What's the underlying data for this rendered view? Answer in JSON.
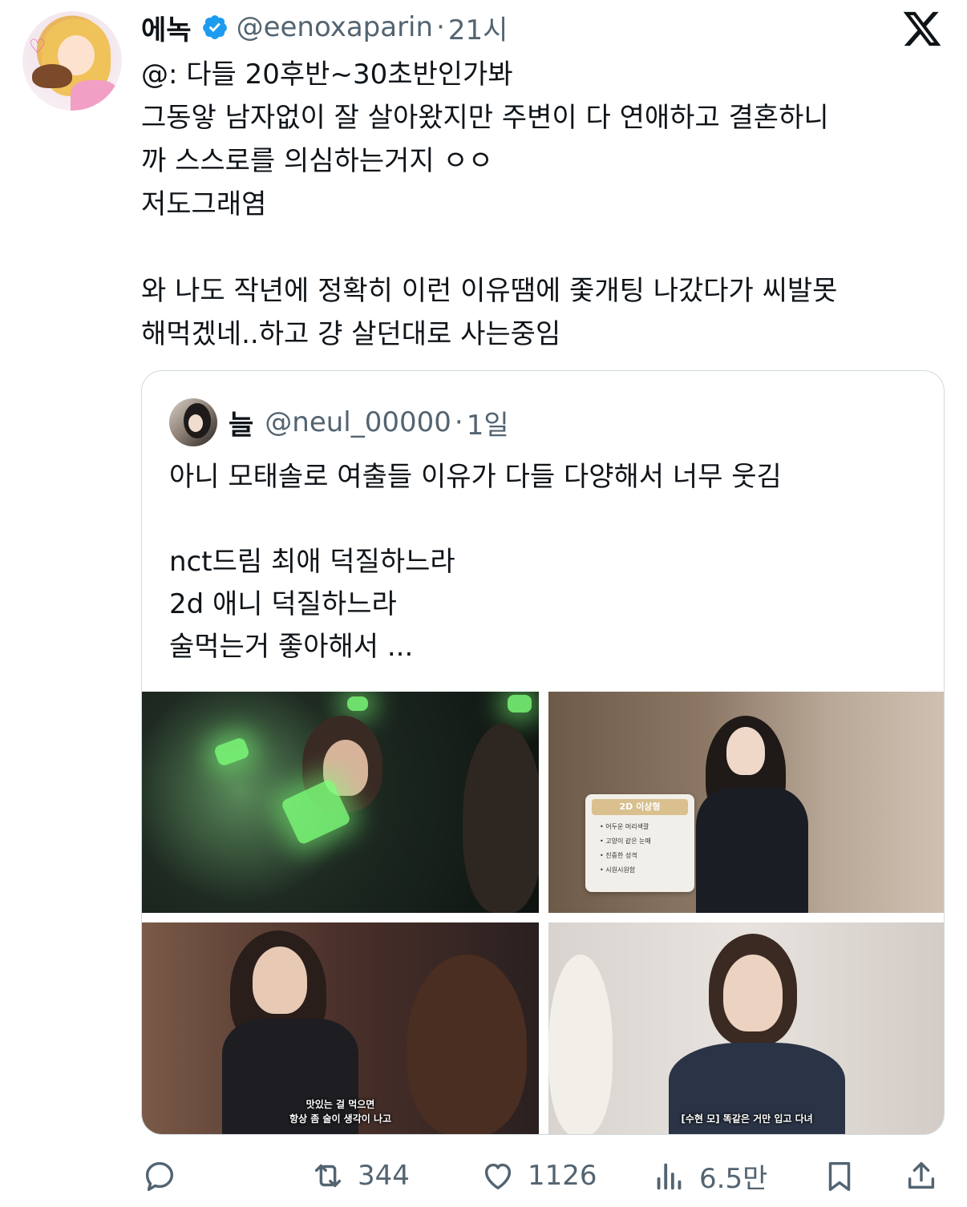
{
  "tweet": {
    "author_name": "에녹",
    "handle": "@eenoxaparin",
    "separator": "·",
    "time": "21시",
    "text": "@: 다들 20후반~30초반인가봐\n그동앟 남자없이 잘 살아왔지만 주변이 다 연애하고 결혼하니\n까 스스로를 의심하는거지 ㅇㅇ\n저도그래염\n\n와 나도 작년에 정확히 이런 이유땜에 좇개팅 나갔다가 씨발못\n해먹겠네..하고 걍 살던대로 사는중임"
  },
  "quote": {
    "author_name": "늘",
    "handle": "@neul_00000",
    "separator": "·",
    "time": "1일",
    "text": "아니 모태솔로 여출들 이유가 다들 다양해서 너무 웃김\n\nnct드림 최애 덕질하느라\n2d 애니 덕질하느라\n술먹는거 좋아해서 ..."
  },
  "media": {
    "card_title": "2D 이상형",
    "card_items": [
      "어두운 머리색깔",
      "고양이 같은 눈매",
      "진중한 성격",
      "시원시원함"
    ],
    "subtitle_3": "맛있는 걸 먹으면\n항상 좀 술이 생각이 나고",
    "subtitle_4": "[수현 모] 똑같은 거만 입고 다녀"
  },
  "actions": {
    "retweets": "344",
    "likes": "1126",
    "views": "6.5만"
  },
  "colors": {
    "text": "#0f1419",
    "secondary": "#536471",
    "verified": "#1d9bf0",
    "border": "#cfd9de"
  },
  "icons": [
    "verified-badge-icon",
    "x-logo-icon",
    "reply-icon",
    "retweet-icon",
    "like-icon",
    "views-icon",
    "bookmark-icon",
    "share-icon"
  ]
}
